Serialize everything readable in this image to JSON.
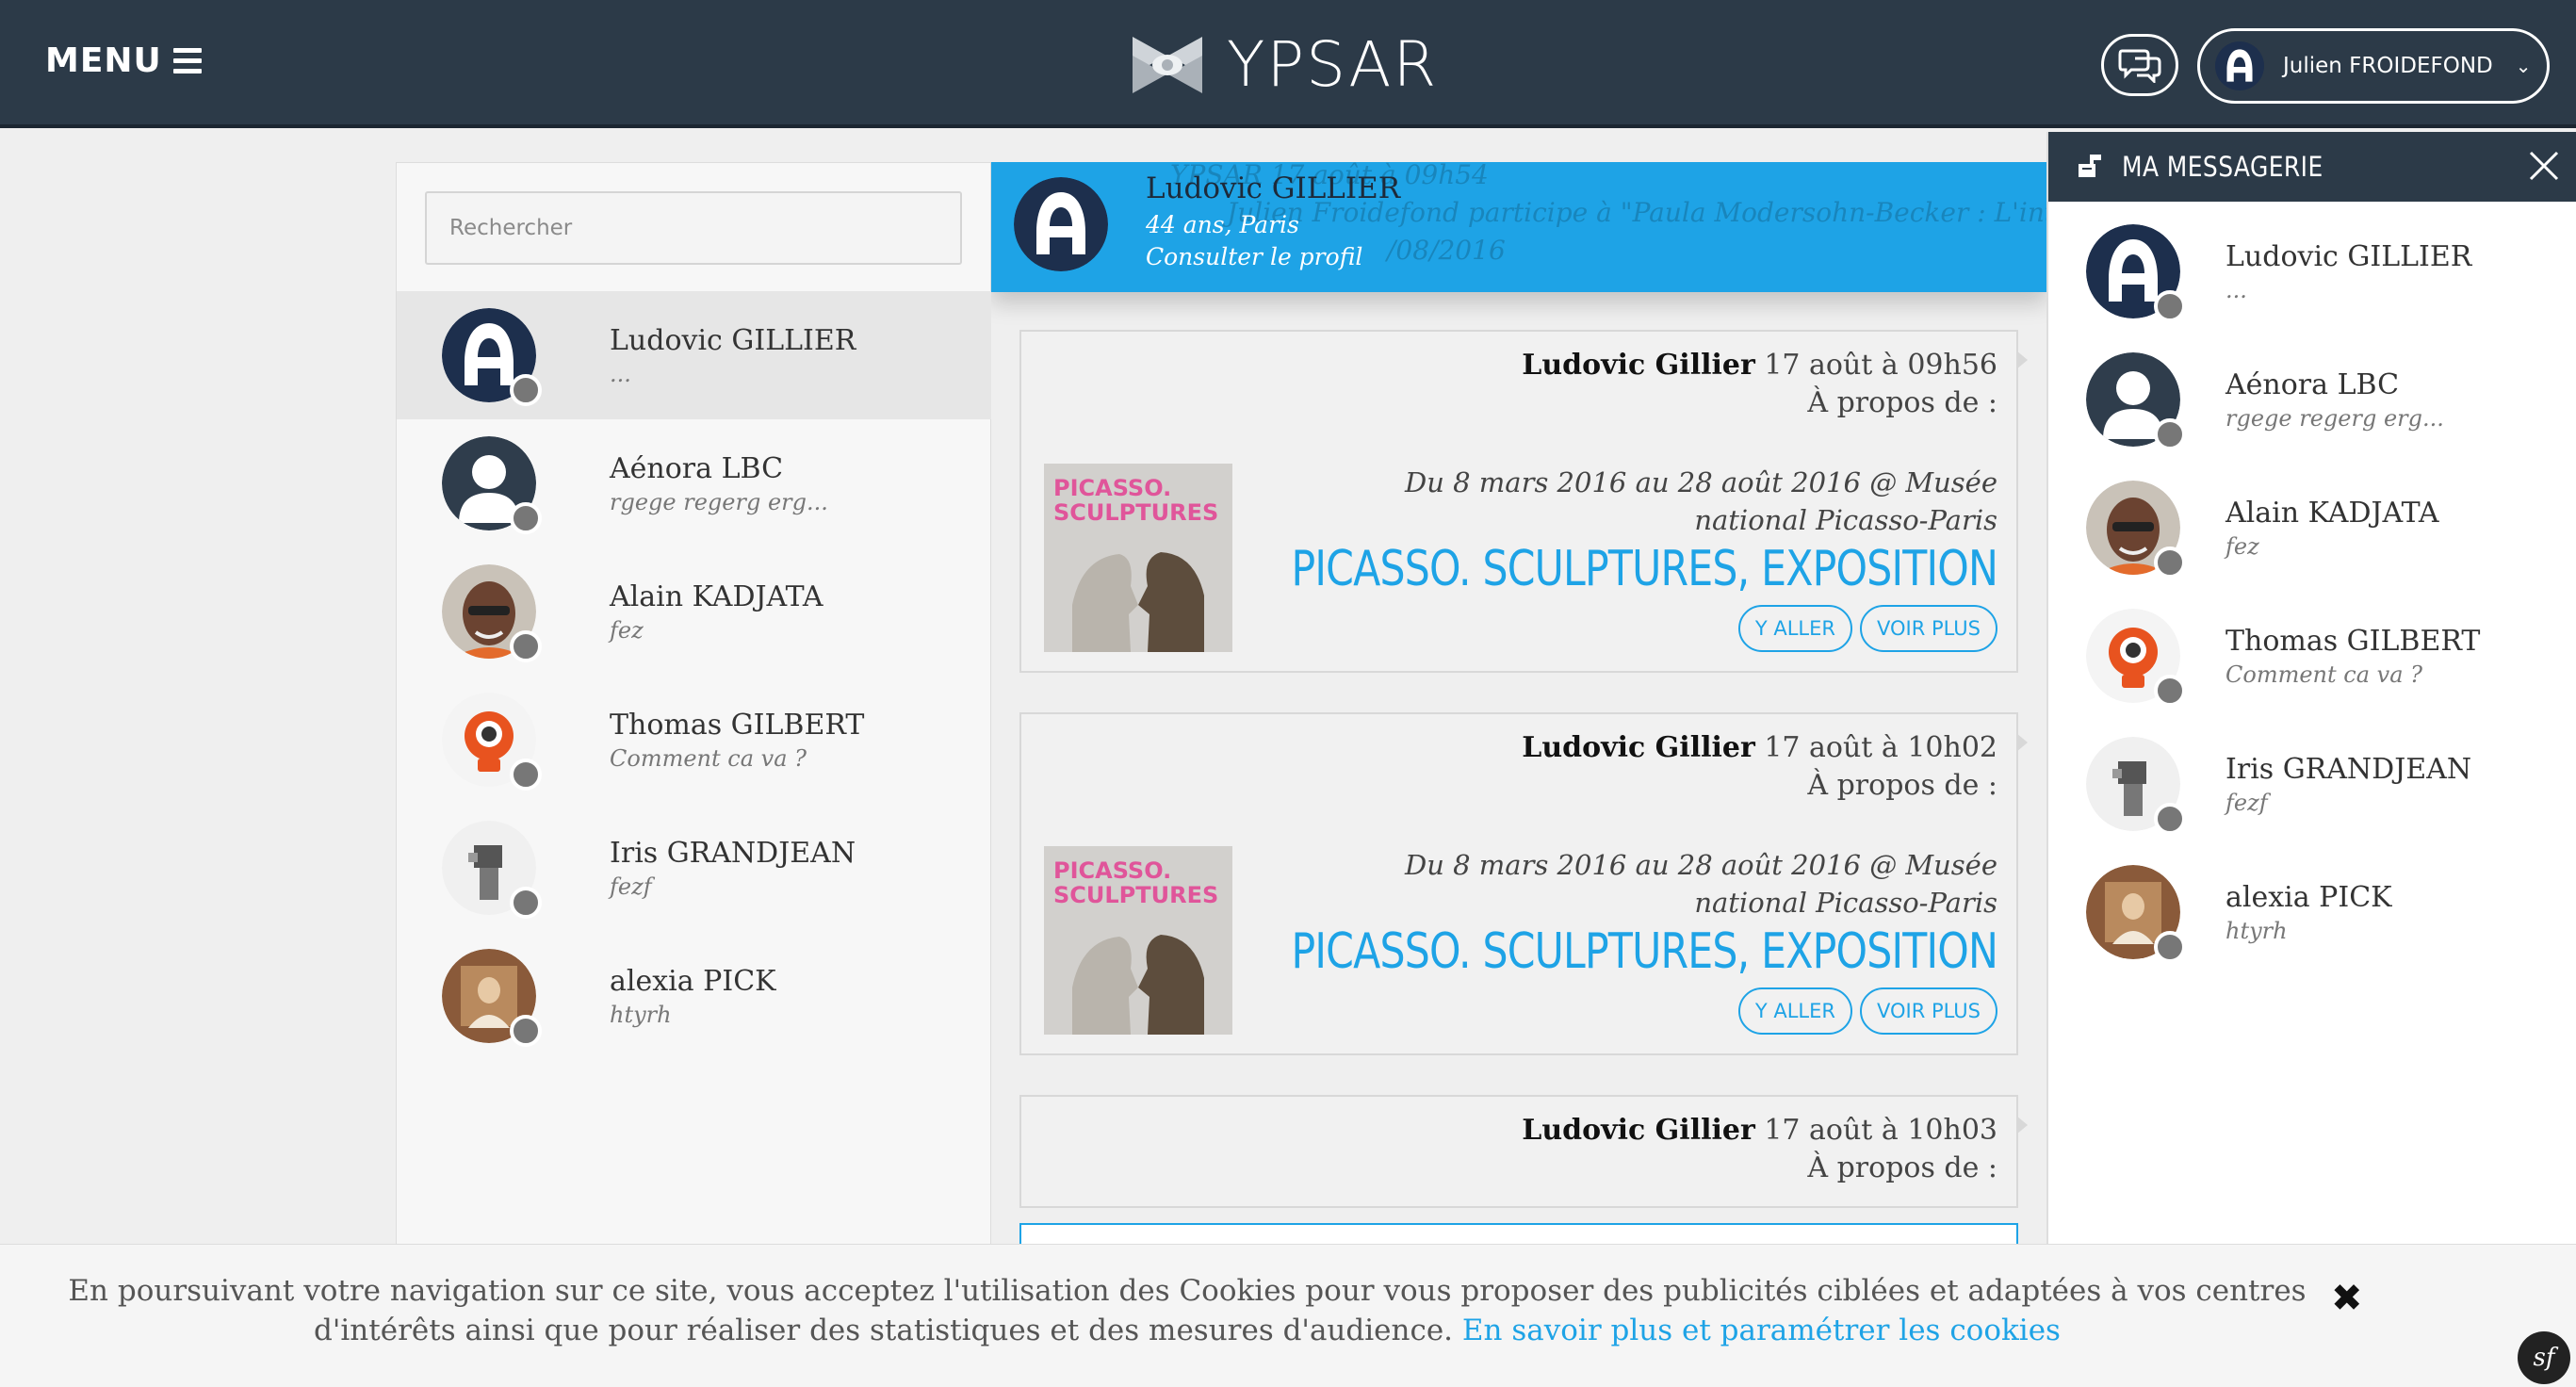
{
  "header": {
    "menu_label": "MENU",
    "logo_text": "YPSAR",
    "user_name": "Julien FROIDEFOND",
    "user_chevron": "⌄",
    "colors": {
      "bar": "#2c3a48",
      "accent": "#1ea3e6"
    }
  },
  "search": {
    "placeholder": "Rechercher"
  },
  "conversations": [
    {
      "name": "Ludovic GILLIER",
      "preview": "...",
      "avatar": "logo-a"
    },
    {
      "name": "Aénora LBC",
      "preview": "rgege regerg erg...",
      "avatar": "person-silhouette"
    },
    {
      "name": "Alain KADJATA",
      "preview": "fez",
      "avatar": "photo-man"
    },
    {
      "name": "Thomas GILBERT",
      "preview": "Comment ca va ?",
      "avatar": "photo-orange"
    },
    {
      "name": "Iris GRANDJEAN",
      "preview": "fezf",
      "avatar": "photo-statue"
    },
    {
      "name": "alexia PICK",
      "preview": "htyrh",
      "avatar": "photo-painting"
    }
  ],
  "profile": {
    "name": "Ludovic GILLIER",
    "subtitle": "44 ans, Paris",
    "link": "Consulter le profil",
    "ghost_line1": "YPSAR 17 août à 09h54",
    "ghost_line2": "Julien Froidefond participe à \"Paula Modersohn-Becker : L'intensité",
    "ghost_line3": "/08/2016"
  },
  "messages": [
    {
      "sender": "Ludovic Gillier",
      "time": "17 août à 09h56",
      "about": "À propos de :",
      "dates": "Du 8 mars 2016 au 28 août 2016 @ Musée national Picasso-Paris",
      "event_title": "PICASSO. SCULPTURES, EXPOSITION",
      "thumb_text": "PICASSO. SCULPTURES",
      "btn_go": "Y ALLER",
      "btn_more": "VOIR PLUS"
    },
    {
      "sender": "Ludovic Gillier",
      "time": "17 août à 10h02",
      "about": "À propos de :",
      "dates": "Du 8 mars 2016 au 28 août 2016 @ Musée national Picasso-Paris",
      "event_title": "PICASSO. SCULPTURES, EXPOSITION",
      "thumb_text": "PICASSO. SCULPTURES",
      "btn_go": "Y ALLER",
      "btn_more": "VOIR PLUS"
    },
    {
      "sender": "Ludovic Gillier",
      "time": "17 août à 10h03",
      "about": "À propos de :"
    }
  ],
  "messagerie": {
    "title": "MA MESSAGERIE",
    "items": [
      {
        "name": "Ludovic GILLIER",
        "preview": "..."
      },
      {
        "name": "Aénora LBC",
        "preview": "rgege regerg erg..."
      },
      {
        "name": "Alain KADJATA",
        "preview": "fez"
      },
      {
        "name": "Thomas GILBERT",
        "preview": "Comment ca va ?"
      },
      {
        "name": "Iris GRANDJEAN",
        "preview": "fezf"
      },
      {
        "name": "alexia PICK",
        "preview": "htyrh"
      }
    ]
  },
  "cookie": {
    "text": "En poursuivant votre navigation sur ce site, vous acceptez l'utilisation des Cookies pour vous proposer des publicités ciblées et adaptées à vos centres d'intérêts ainsi que pour réaliser des statistiques et des mesures d'audience.",
    "link": "En savoir plus et paramétrer les cookies",
    "close": "✖"
  },
  "debug_badge": "sf"
}
